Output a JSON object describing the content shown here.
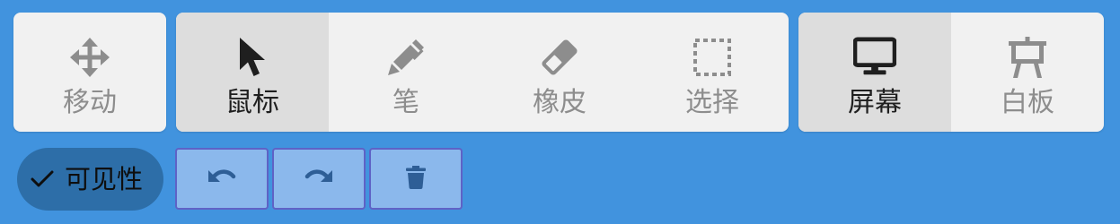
{
  "toolbar": {
    "move": {
      "label": "移动",
      "icon": "move-arrows-icon"
    },
    "tools": {
      "mouse": {
        "label": "鼠标",
        "icon": "cursor-icon",
        "active": true
      },
      "pen": {
        "label": "笔",
        "icon": "pen-icon"
      },
      "eraser": {
        "label": "橡皮",
        "icon": "eraser-icon"
      },
      "select": {
        "label": "选择",
        "icon": "dashed-selection-icon"
      }
    },
    "view": {
      "screen": {
        "label": "屏幕",
        "icon": "monitor-icon",
        "active": true
      },
      "whiteboard": {
        "label": "白板",
        "icon": "whiteboard-easel-icon"
      }
    }
  },
  "actions": {
    "visibility": {
      "label": "可见性",
      "icon": "checkmark-icon",
      "checked": true
    },
    "undo": {
      "icon": "undo-icon"
    },
    "redo": {
      "icon": "redo-icon"
    },
    "delete": {
      "icon": "trash-icon"
    }
  },
  "colors": {
    "background": "#4193DE",
    "panel": "#F1F1F1",
    "active_tile": "#DDDDDD",
    "inactive_text": "#8D8D8D",
    "active_text": "#1F1F1F",
    "visibility_pill": "#2D6EA8",
    "history_button": "#8BB8EC",
    "history_button_border": "#5F62C6",
    "history_icon": "#2E5E96"
  }
}
